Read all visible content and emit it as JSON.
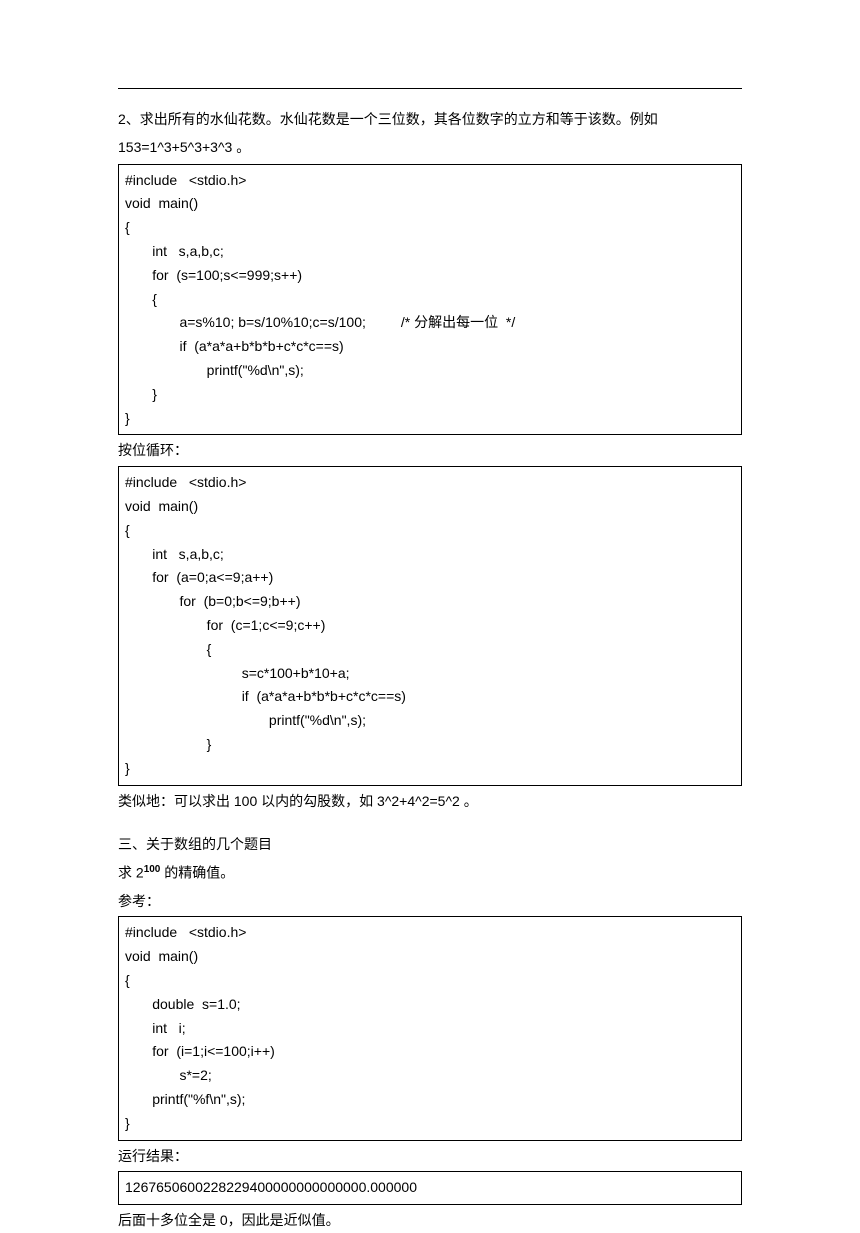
{
  "intro": {
    "problem_line1": "2、求出所有的水仙花数。水仙花数是一个三位数，其各位数字的立方和等于该数。例如",
    "problem_line2": "153=1^3+5^3+3^3 。"
  },
  "code1": "#include   <stdio.h>\nvoid  main()\n{\n       int   s,a,b,c;\n       for  (s=100;s<=999;s++)\n       {\n              a=s%10; b=s/10%10;c=s/100;         /* 分解出每一位  */\n              if  (a*a*a+b*b*b+c*c*c==s)\n                     printf(\"%d\\n\",s);\n       }\n}",
  "label_loop": "按位循环：",
  "code2": "#include   <stdio.h>\nvoid  main()\n{\n       int   s,a,b,c;\n       for  (a=0;a<=9;a++)\n              for  (b=0;b<=9;b++)\n                     for  (c=1;c<=9;c++)\n                     {\n                              s=c*100+b*10+a;\n                              if  (a*a*a+b*b*b+c*c*c==s)\n                                     printf(\"%d\\n\",s);\n                     }\n}",
  "similar_note": "类似地：可以求出     100 以内的勾股数，如     3^2+4^2=5^2 。",
  "section3_title": "三、关于数组的几个题目",
  "exponent_line_pre": "求 2",
  "exponent_sup": "100",
  "exponent_line_post": " 的精确值。",
  "ref_label": "参考：",
  "code3": "#include   <stdio.h>\nvoid  main()\n{\n       double  s=1.0;\n       int   i;\n       for  (i=1;i<=100;i++)\n              s*=2;\n       printf(\"%f\\n\",s);\n}",
  "result_label": "运行结果：",
  "result_value": "1267650600228229400000000000000.000000",
  "conclusion": "后面十多位全是     0，因此是近似值。"
}
